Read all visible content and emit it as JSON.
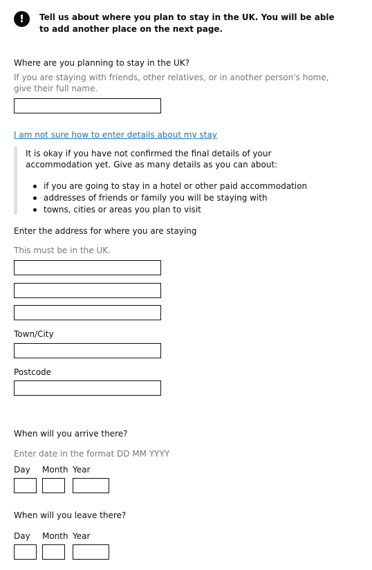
{
  "notice": {
    "icon": "exclamation-icon",
    "icon_glyph": "!",
    "text": "Tell us about where you plan to stay in the UK. You will be able to add another place on the next page."
  },
  "stay_name": {
    "label": "Where are you planning to stay in the UK?",
    "hint": "If you are staying with friends, other relatives, or in another person's home, give their full name.",
    "value": ""
  },
  "details": {
    "link_text": "I am not sure how to enter details about my stay",
    "intro": "It is okay if you have not confirmed the final details of your accommodation yet. Give as many details as you can about:",
    "items": [
      "if you are going to stay in a hotel or other paid accommodation",
      "addresses of friends or family you will be staying with",
      "towns, cities or areas you plan to visit"
    ]
  },
  "address": {
    "label": "Enter the address for where you are staying",
    "hint": "This must be in the UK.",
    "line1": "",
    "line2": "",
    "line3": "",
    "town_label": "Town/City",
    "town": "",
    "postcode_label": "Postcode",
    "postcode": ""
  },
  "arrive": {
    "label": "When will you arrive there?",
    "hint": "Enter date in the format DD MM YYYY",
    "day_label": "Day",
    "month_label": "Month",
    "year_label": "Year",
    "day": "",
    "month": "",
    "year": ""
  },
  "leave": {
    "label": "When will you leave there?",
    "day_label": "Day",
    "month_label": "Month",
    "year_label": "Year",
    "day": "",
    "month": "",
    "year": ""
  }
}
